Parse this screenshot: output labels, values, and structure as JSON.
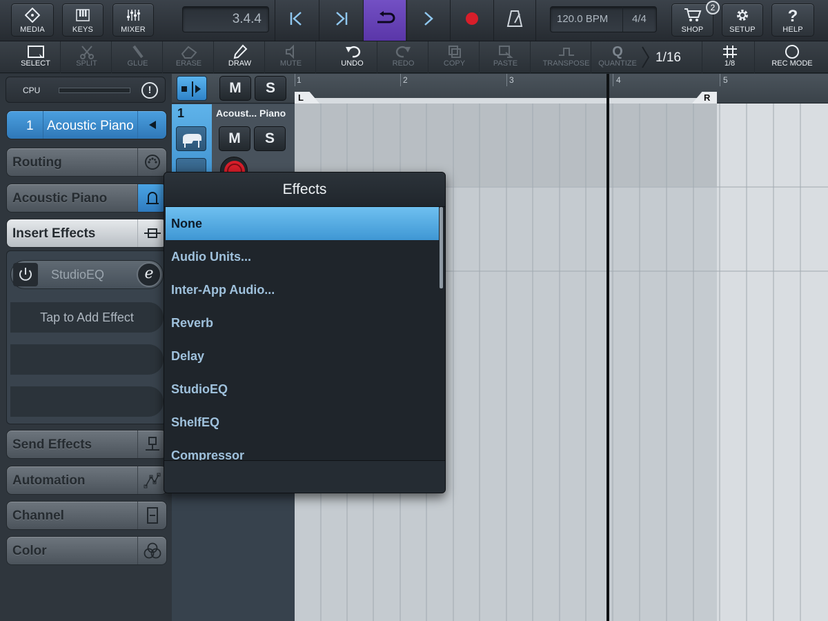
{
  "topbar": {
    "media": "MEDIA",
    "keys": "KEYS",
    "mixer": "MIXER",
    "position": "3.4.4",
    "tempo": "120.0 BPM",
    "signature": "4/4",
    "shop": "SHOP",
    "shop_badge": "2",
    "setup": "SETUP",
    "help": "HELP"
  },
  "tools": {
    "select": "SELECT",
    "split": "SPLIT",
    "glue": "GLUE",
    "erase": "ERASE",
    "draw": "DRAW",
    "mute": "MUTE",
    "undo": "UNDO",
    "redo": "REDO",
    "copy": "COPY",
    "paste": "PASTE",
    "transpose": "TRANSPOSE",
    "quantize": "QUANTIZE",
    "quantize_value": "1/16",
    "grid": "1/8",
    "rec_mode": "REC MODE"
  },
  "sidebar": {
    "cpu": "CPU",
    "track_number": "1",
    "track_name": "Acoustic Piano",
    "routing": "Routing",
    "instrument": "Acoustic Piano",
    "insert_effects": "Insert Effects",
    "insert_slot_name": "StudioEQ",
    "insert_slot_edit": "e",
    "tap_to_add": "Tap to Add Effect",
    "send_effects": "Send Effects",
    "automation": "Automation",
    "channel": "Channel",
    "color": "Color"
  },
  "track": {
    "number": "1",
    "name": "Acoust... Piano",
    "mute": "M",
    "solo": "S"
  },
  "ruler": {
    "bars": [
      "1",
      "2",
      "3",
      "4",
      "5"
    ],
    "left_locator": "L",
    "right_locator": "R"
  },
  "effects": {
    "title": "Effects",
    "items": [
      "None",
      "Audio Units...",
      "Inter-App Audio...",
      "Reverb",
      "Delay",
      "StudioEQ",
      "ShelfEQ",
      "Compressor"
    ],
    "selected": "None"
  },
  "colors": {
    "accent_blue": "#3f97d4",
    "play_purple": "#6640b8",
    "record_red": "#d81e2a"
  }
}
